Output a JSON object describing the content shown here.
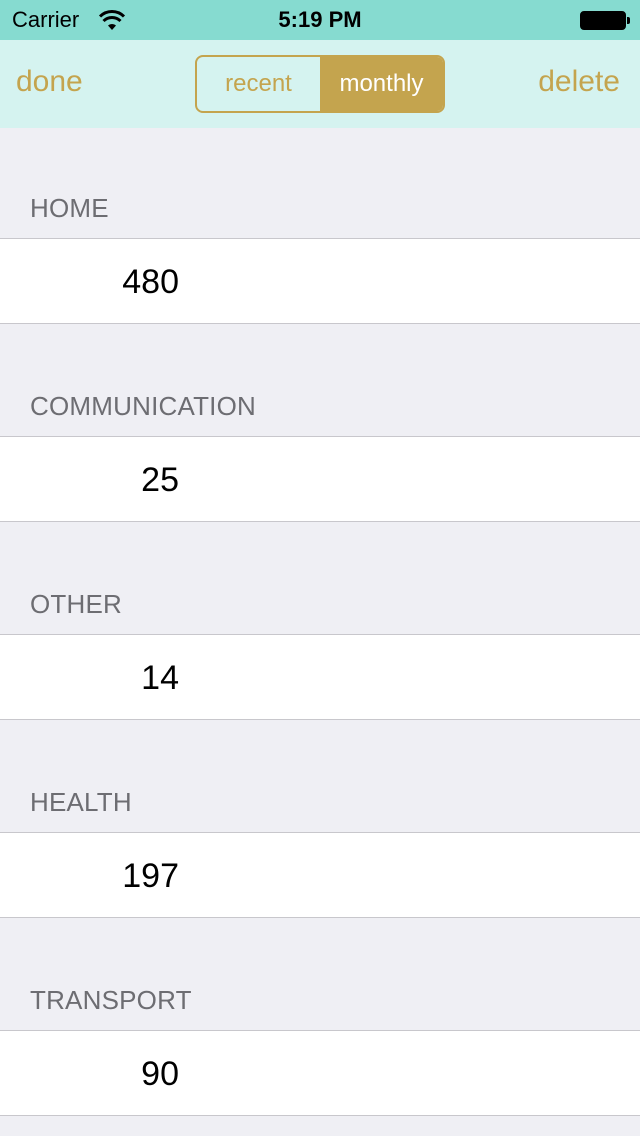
{
  "status_bar": {
    "carrier": "Carrier",
    "time": "5:19 PM",
    "battery_level": 1.0
  },
  "nav_bar": {
    "left_button": "done",
    "right_button": "delete",
    "segments": [
      {
        "label": "recent",
        "selected": false
      },
      {
        "label": "monthly",
        "selected": true
      }
    ]
  },
  "sections": [
    {
      "title": "HOME",
      "value": "480"
    },
    {
      "title": "COMMUNICATION",
      "value": "25"
    },
    {
      "title": "OTHER",
      "value": "14"
    },
    {
      "title": "HEALTH",
      "value": "197"
    },
    {
      "title": "TRANSPORT",
      "value": "90"
    }
  ],
  "colors": {
    "accent": "#c4a44e",
    "status_bar": "#86dbd0",
    "nav_bar": "#d5f3f0",
    "background": "#efeff4"
  }
}
